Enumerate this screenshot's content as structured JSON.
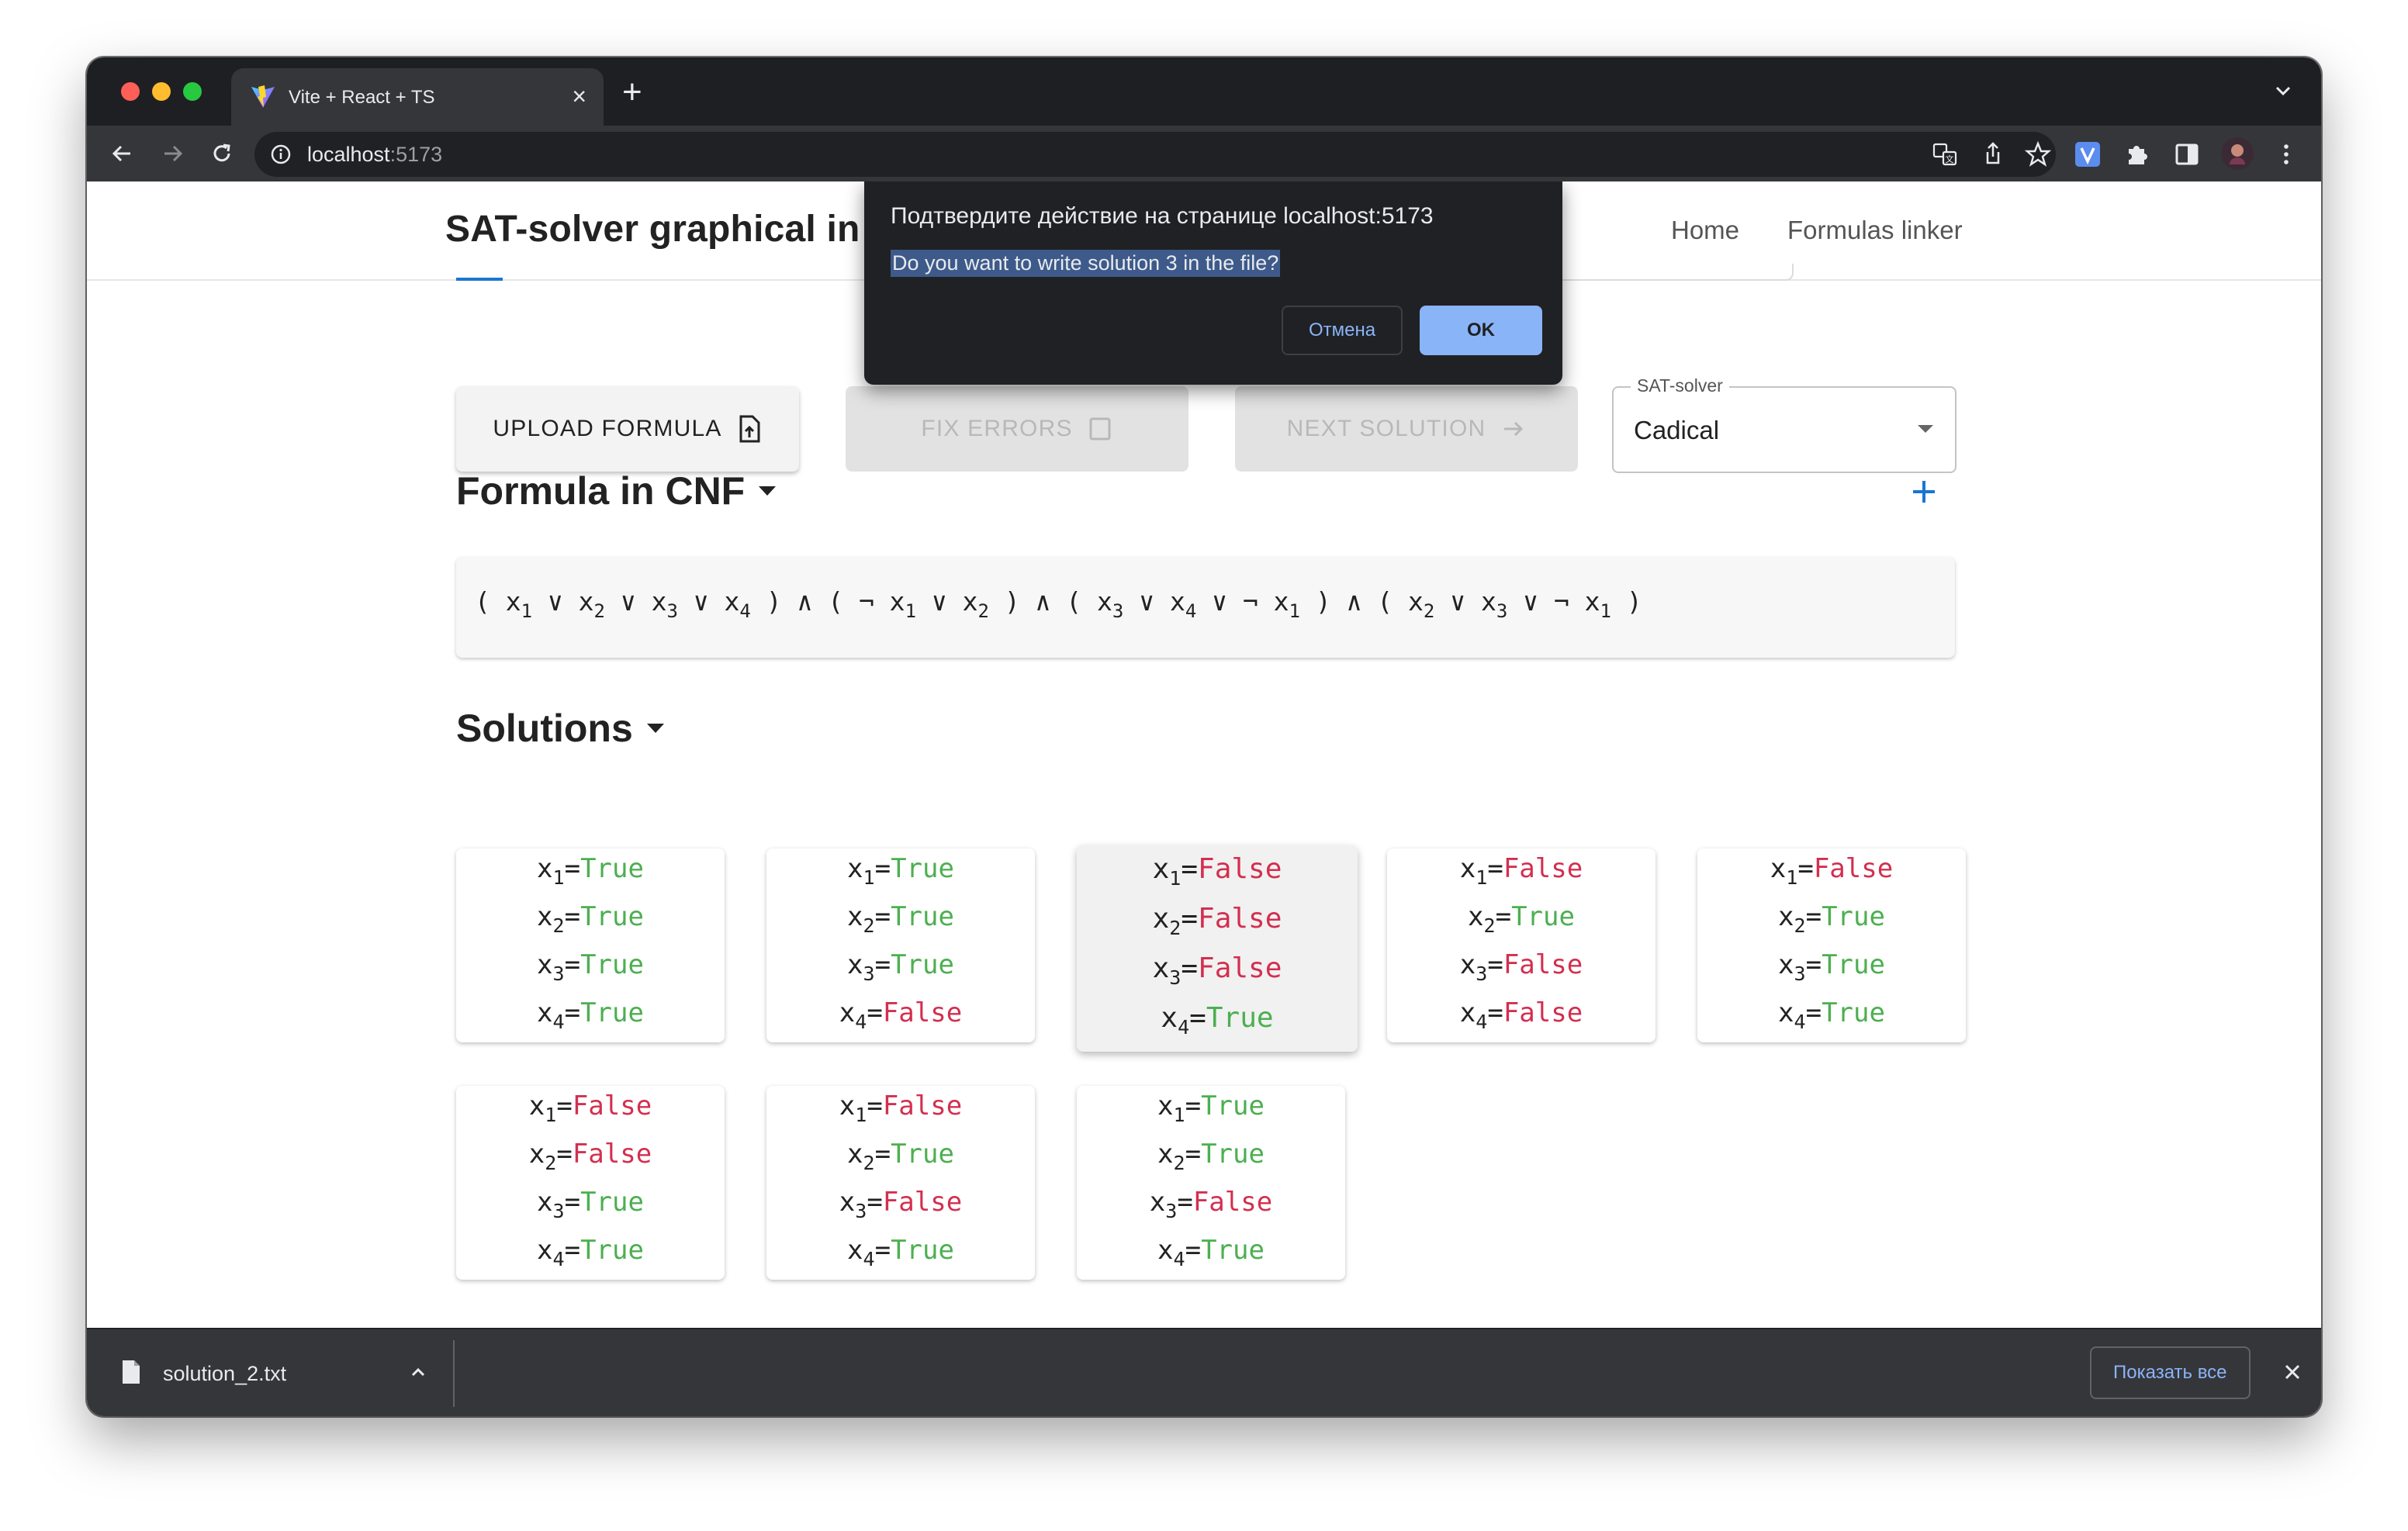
{
  "browser": {
    "tab_title": "Vite + React + TS",
    "url_host": "localhost",
    "url_port": ":5173"
  },
  "app": {
    "title": "SAT-solver graphical in",
    "nav": [
      "Home",
      "Formulas linker"
    ]
  },
  "actions": {
    "upload_label": "UPLOAD FORMULA",
    "fix_label": "FIX ERRORS",
    "next_label": "NEXT SOLUTION",
    "solver_label": "SAT-solver",
    "solver_value": "Cadical"
  },
  "formula": {
    "heading": "Formula in CNF",
    "text": "(x₁∨x₂∨x₃∨x₄)∧(¬x₁∨x₂)∧(x₃∨x₄∨¬x₁)∧(x₂∨x₃∨¬x₁)"
  },
  "solutions": {
    "heading": "Solutions",
    "selected_index": 2,
    "items": [
      [
        "True",
        "True",
        "True",
        "True"
      ],
      [
        "True",
        "True",
        "True",
        "False"
      ],
      [
        "False",
        "False",
        "False",
        "True"
      ],
      [
        "False",
        "True",
        "False",
        "False"
      ],
      [
        "False",
        "True",
        "True",
        "True"
      ],
      [
        "False",
        "False",
        "True",
        "True"
      ],
      [
        "False",
        "True",
        "False",
        "True"
      ],
      [
        "True",
        "True",
        "False",
        "True"
      ]
    ]
  },
  "dialog": {
    "title": "Подтвердите действие на странице localhost:5173",
    "message": "Do you want to write solution 3 in the file?",
    "cancel": "Отмена",
    "ok": "OK"
  },
  "downloads": {
    "file_name": "solution_2.txt",
    "show_all": "Показать все"
  },
  "colors": {
    "true": "#4caf50",
    "false": "#d32f4f",
    "accent": "#1976d2"
  }
}
